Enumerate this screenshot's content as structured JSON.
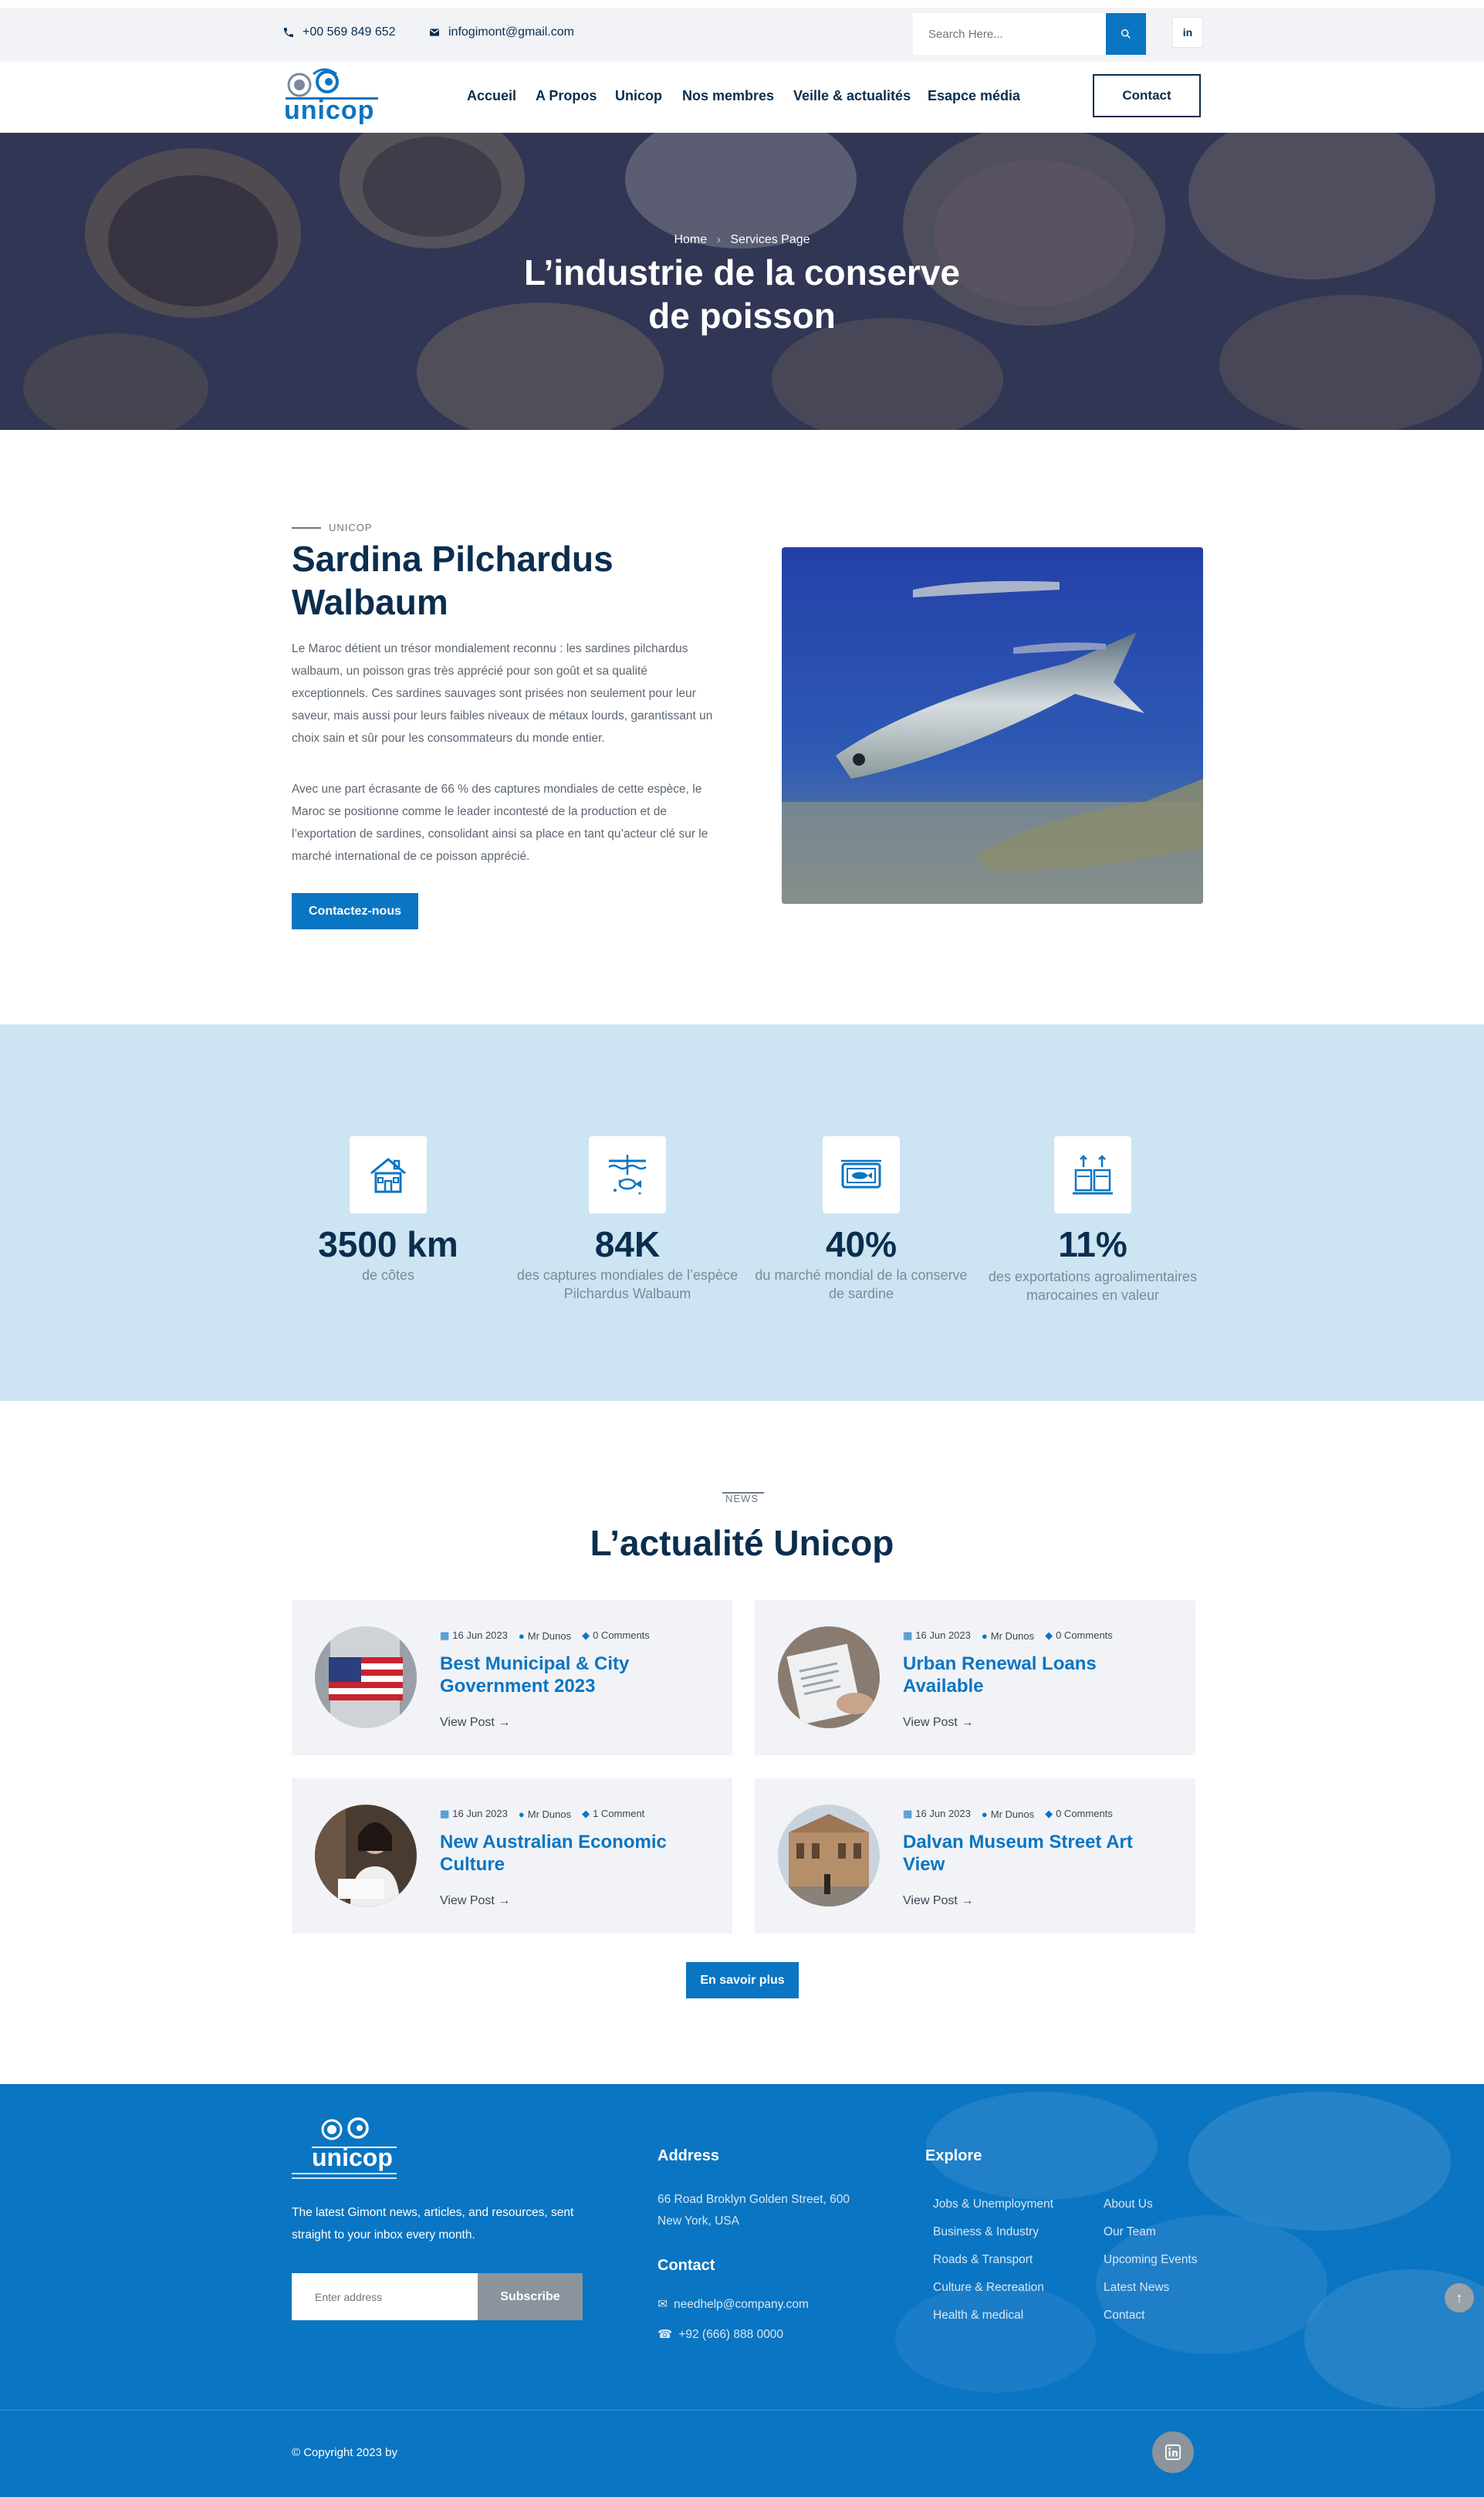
{
  "topbar": {
    "phone": "+00 569 849 652",
    "email": "infogimont@gmail.com",
    "search_placeholder": "Search Here...",
    "linkedin": "in"
  },
  "nav": {
    "logo_text": "unicop",
    "items": [
      "Accueil",
      "A Propos",
      "Unicop",
      "Nos membres",
      "Veille & actualités",
      "Esapce média"
    ],
    "contact_label": "Contact"
  },
  "hero": {
    "breadcrumb_home": "Home",
    "breadcrumb_sep": "›",
    "breadcrumb_current": "Services Page",
    "title_line1": "L’industrie de la conserve",
    "title_line2": "de poisson"
  },
  "intro": {
    "tag": "UNICOP",
    "title": "Sardina Pilchardus Walbaum",
    "paragraph1": "Le Maroc détient un trésor mondialement reconnu : les sardines pilchardus walbaum, un poisson gras très apprécié pour son goût et sa qualité exceptionnels. Ces sardines sauvages sont prisées non seulement pour leur saveur, mais aussi pour leurs faibles niveaux de métaux lourds, garantissant un choix sain et sûr pour les consommateurs du monde entier.",
    "paragraph2": "Avec une part écrasante de 66 % des captures mondiales de cette espèce, le Maroc se positionne comme le leader incontesté de la production et de l’exportation de sardines, consolidant ainsi sa place en tant qu’acteur clé sur le marché international de ce poisson apprécié.",
    "button": "Contactez-nous"
  },
  "stats": [
    {
      "icon": "house-icon",
      "value": "3500 km",
      "label": "de côtes"
    },
    {
      "icon": "fishing-icon",
      "value": "84K",
      "label": "des captures mondiales de l’espèce Pilchardus Walbaum"
    },
    {
      "icon": "sardine-can-icon",
      "value": "40%",
      "label": "du marché mondial de la conserve de sardine"
    },
    {
      "icon": "pallet-icon",
      "value": "11%",
      "label": "des exportations agroalimentaires marocaines en valeur"
    }
  ],
  "news": {
    "tag": "NEWS",
    "title": "L’actualité Unicop",
    "cards": [
      {
        "date": "16 Jun 2023",
        "author": "Mr Dunos",
        "comments": "0 Comments",
        "title": "Best Municipal & City Government 2023",
        "link": "View Post"
      },
      {
        "date": "16 Jun 2023",
        "author": "Mr Dunos",
        "comments": "0 Comments",
        "title": "Urban Renewal Loans Available",
        "link": "View Post"
      },
      {
        "date": "16 Jun 2023",
        "author": "Mr Dunos",
        "comments": "1 Comment",
        "title": "New Australian Economic Culture",
        "link": "View Post"
      },
      {
        "date": "16 Jun 2023",
        "author": "Mr Dunos",
        "comments": "0 Comments",
        "title": "Dalvan Museum Street Art View",
        "link": "View Post"
      }
    ],
    "more_button": "En savoir plus"
  },
  "footer": {
    "logo_text": "unicop",
    "tagline": "The latest Gimont news, articles, and resources, sent straight to your inbox every month.",
    "newsletter_placeholder": "Enter address",
    "subscribe": "Subscribe",
    "address_heading": "Address",
    "address_line1": "66 Road Broklyn Golden Street, 600",
    "address_line2": "New York, USA",
    "contact_heading": "Contact",
    "contact_email": "needhelp@company.com",
    "contact_phone": "+92 (666) 888 0000",
    "explore_heading": "Explore",
    "explore_col1": [
      "Jobs & Unemployment",
      "Business & Industry",
      "Roads & Transport",
      "Culture & Recreation",
      "Health & medical"
    ],
    "explore_col2": [
      "About Us",
      "Our Team",
      "Upcoming Events",
      "Latest News",
      "Contact"
    ],
    "copyright": "© Copyright 2023 by"
  },
  "colors": {
    "brand": "#0a75c2",
    "navy": "#0b2e4f",
    "stats_bg": "#cde4f2"
  }
}
